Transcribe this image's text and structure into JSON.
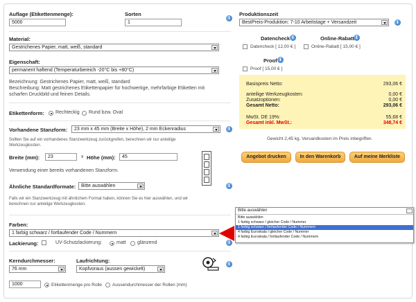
{
  "left": {
    "auflage_label": "Auflage (Etikettenmenge):",
    "auflage_value": "5000",
    "sorten_label": "Sorten",
    "sorten_value": "1",
    "material_label": "Material:",
    "material_value": "Gestrichenes Papier, matt, weiß, standard",
    "eigenschaft_label": "Eigenschaft:",
    "eigenschaft_value": "permanent haftend (Temperaturbereich -20°C bis +80°C)",
    "bezeichnung": "Bezeichnung: Gestrichenes Papier, matt, weiß, standard",
    "beschreibung_1": "Beschreibung: Matt gestrichenes Etikettenpapier für hochwertige, mehrfarbige Etiketten mit",
    "beschreibung_2": "scharfen Druckbild und feinen Details.",
    "etikettenform_label": "Etikettenform:",
    "form_rechteckig": "Rechteckig",
    "form_rund": "Rund bzw. Oval",
    "stanzform_label": "Vorhandene Stanzform:",
    "stanzform_value": "23 mm x 45 mm (Breite x Höhe), 2 mm Eckenradius",
    "stanzform_hint_1": "Sollten Sie auf ein vorhandenes Stanzwerkzeug zurückgreifen, berechnen wir nur anteilige",
    "stanzform_hint_2": "Werkzeugkosten.",
    "breite_label": "Breite (mm):",
    "breite_value": "23",
    "x": "x",
    "hoehe_label": "Höhe (mm):",
    "hoehe_value": "45",
    "verwendung": "Verwendung einer bereits vorhandenen Stanzform.",
    "aehnliche_label": "Ähnliche Standardformate:",
    "aehnliche_value": "Bitte auswählen",
    "aehnliche_hint_1": "Falls wir ein Stanzwerkzeug mit ähnlichem Format haben, können Sie es hier auswählen, und wir",
    "aehnliche_hint_2": "berechnen nur anteilige Werkzeugkosten.",
    "farben_label": "Farben:",
    "farben_value": "1 farbig schwarz / fortlaufender Code / Nummern",
    "lackierung_label": "Lackierung:",
    "uv_label": "UV-Schutzlackierung:",
    "uv_matt": "matt",
    "uv_glaenzend": "glänzend",
    "kern_label": "Kerndurchmesser:",
    "kern_value": "76 mm",
    "lauf_label": "Laufrichtung:",
    "lauf_value": "Kopfvoraus (aussen gewickelt)",
    "rolle_value": "1000",
    "rolle_opt1": "Etikettenmenge pro Rolle",
    "rolle_opt2": "Aussendurchmesser der Rollen (mm)"
  },
  "right": {
    "produktionszeit_label": "Produktionszeit",
    "produktionszeit_value": "BestPreis-Produktion: 7-10 Arbeitstage + Versandzeit",
    "datencheck_label": "Datencheck",
    "datencheck_opt": "Datencheck [ 12,00 € ]",
    "rabatt_label": "Online-Rabatt",
    "rabatt_opt": "Online-Rabatt [ 15,00 € ]",
    "proof_label": "Proof",
    "proof_opt": "Proof [ 15,00 € ]",
    "prices": {
      "basis_label": "Basispreis Netto:",
      "basis_value": "293,06 €",
      "werkzeug_label": "anteilige Werkzeugkosten:",
      "werkzeug_value": "0,00 €",
      "zusatz_label": "Zusatzoptionen:",
      "zusatz_value": "0,00 €",
      "gesamt_label": "Gesamt Netto:",
      "gesamt_value": "293,06 €",
      "mwst_label": "MwSt. DE 19%:",
      "mwst_value": "55,68 €",
      "brutto_label": "Gesamt inkl. MwSt.:",
      "brutto_value": "348,74 €"
    },
    "gewicht": "Gewicht 2,45 kg. Versandkosten im Preis inbegriffen.",
    "btn_angebot": "Angebot drucken",
    "btn_warenkorb": "In den Warenkorb",
    "btn_merkliste": "Auf meine Merkliste"
  },
  "dropdown": {
    "head": "Bitte auswählen",
    "items": [
      "Bitte auswählen",
      "1 farbig schwarz / gleicher Code / Nummer",
      "1 farbig schwarz / fortlaufender Code / Nummern",
      "4 farbig Euroskala / gleicher Code / Nummer",
      "4 farbig Euroskala / fortlaufender Code / Nummern"
    ],
    "selected_index": 2
  },
  "colors": {
    "accent_red": "#e00000",
    "price_box": "#fff4b8",
    "button": "#f2a93b",
    "info_blue": "#2f6fc1",
    "selection_blue": "#3f6fd1"
  }
}
